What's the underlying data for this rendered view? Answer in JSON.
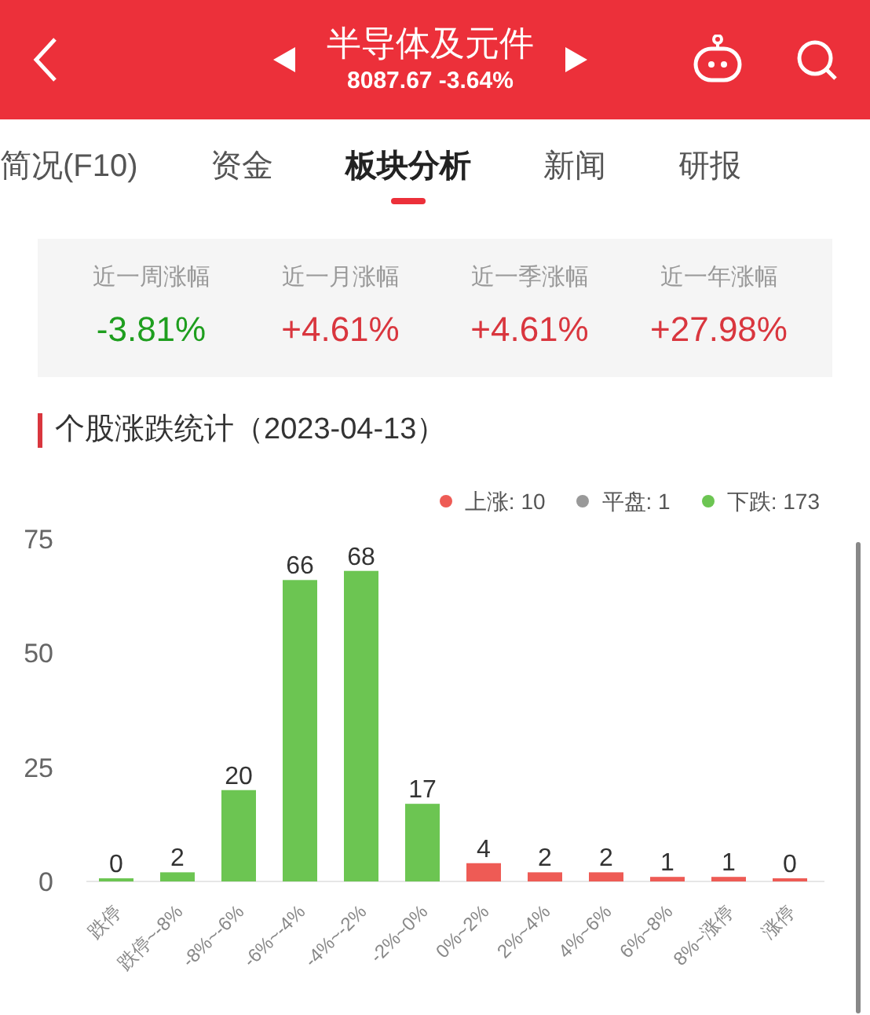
{
  "header": {
    "title": "半导体及元件",
    "quote": "8087.67 -3.64%"
  },
  "tabs": [
    {
      "label": "简况(F10)",
      "selected": false
    },
    {
      "label": "资金",
      "selected": false
    },
    {
      "label": "板块分析",
      "selected": true
    },
    {
      "label": "新闻",
      "selected": false
    },
    {
      "label": "研报",
      "selected": false
    }
  ],
  "stats": [
    {
      "label": "近一周涨幅",
      "value": "-3.81%",
      "color": "#1e9e1e"
    },
    {
      "label": "近一月涨幅",
      "value": "+4.61%",
      "color": "#d9363e"
    },
    {
      "label": "近一季涨幅",
      "value": "+4.61%",
      "color": "#d9363e"
    },
    {
      "label": "近一年涨幅",
      "value": "+27.98%",
      "color": "#d9363e"
    }
  ],
  "section_title": "个股涨跌统计（2023-04-13）",
  "legend": [
    {
      "label": "上涨: 10",
      "color": "#ee5b55"
    },
    {
      "label": "平盘: 1",
      "color": "#999999"
    },
    {
      "label": "下跌: 173",
      "color": "#6cc552"
    }
  ],
  "chart_data": {
    "type": "bar",
    "categories": [
      "跌停",
      "跌停~-8%",
      "-8%~-6%",
      "-6%~-4%",
      "-4%~-2%",
      "-2%~0%",
      "0%~2%",
      "2%~4%",
      "4%~6%",
      "6%~8%",
      "8%~涨停",
      "涨停"
    ],
    "series": [
      {
        "color": "#6cc552",
        "values": [
          0,
          2,
          20,
          66,
          68,
          17,
          null,
          null,
          null,
          null,
          null,
          null
        ]
      },
      {
        "color": "#ee5b55",
        "values": [
          null,
          null,
          null,
          null,
          null,
          null,
          4,
          2,
          2,
          1,
          1,
          0
        ]
      }
    ],
    "ylim": [
      0,
      75
    ],
    "yticks": [
      0,
      25,
      50,
      75
    ],
    "data_labels": true
  }
}
